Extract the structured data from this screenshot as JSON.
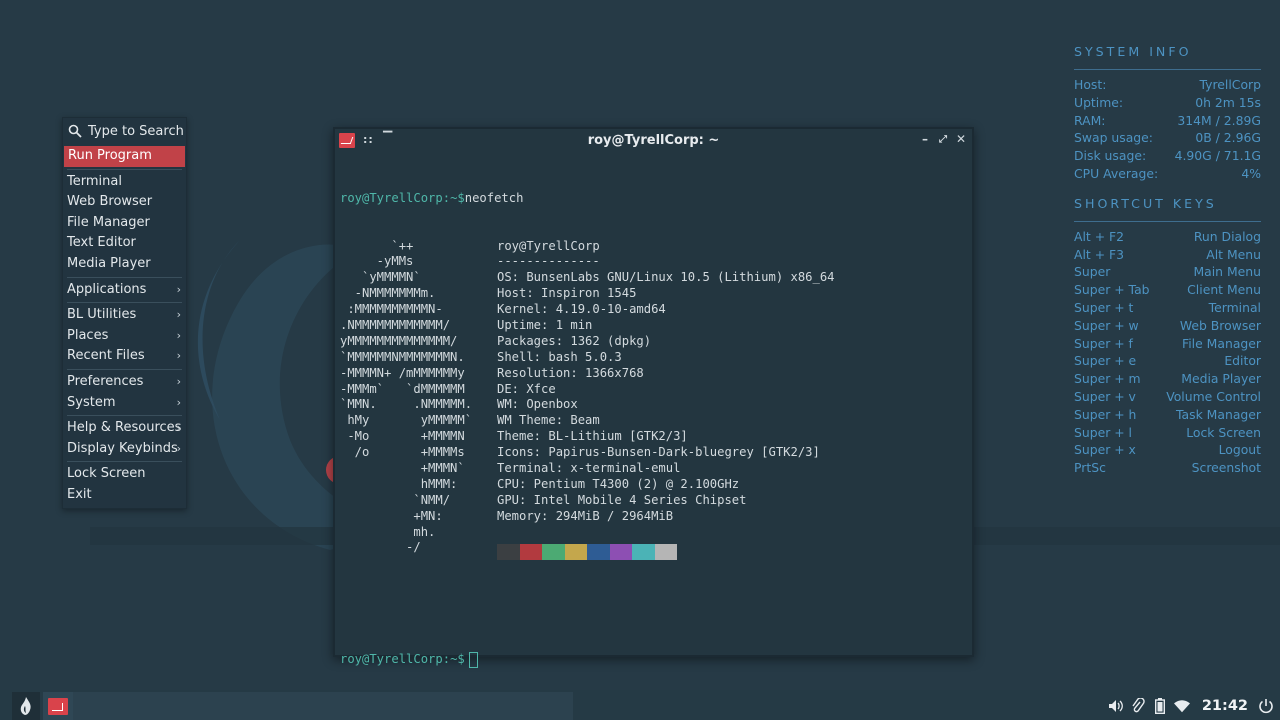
{
  "menu": {
    "search_label": "Type to Search",
    "items": [
      {
        "label": "Run Program",
        "active": true
      },
      {
        "label": "Terminal"
      },
      {
        "label": "Web Browser"
      },
      {
        "label": "File Manager"
      },
      {
        "label": "Text Editor"
      },
      {
        "label": "Media Player"
      },
      {
        "label": "Applications",
        "submenu": true
      },
      {
        "label": "BL Utilities",
        "submenu": true
      },
      {
        "label": "Places",
        "submenu": true
      },
      {
        "label": "Recent Files",
        "submenu": true
      },
      {
        "label": "Preferences",
        "submenu": true
      },
      {
        "label": "System",
        "submenu": true
      },
      {
        "label": "Help & Resources",
        "submenu": true
      },
      {
        "label": "Display Keybinds",
        "submenu": true
      },
      {
        "label": "Lock Screen"
      },
      {
        "label": "Exit"
      }
    ],
    "submenu_arrow": "›"
  },
  "terminal": {
    "title": "roy@TyrellCorp: ~",
    "prompt_user": "roy@TyrellCorp",
    "prompt_path": ":~$",
    "command": "neofetch",
    "logo": [
      "       `++",
      "     -yMMs",
      "   `yMMMMN`",
      "  -NMMMMMMMm.",
      " :MMMMMMMMMMN-",
      ".NMMMMMMMMMMMM/",
      "yMMMMMMMMMMMMMM/",
      "`MMMMMMNMMMMMMMN.",
      "-MMMMN+ /mMMMMMMy",
      "-MMMm`   `dMMMMMM",
      "`MMN.     .NMMMMM.",
      " hMy       yMMMMM`",
      " -Mo       +MMMMN",
      "  /o       +MMMMs",
      "           +MMMN`",
      "           hMMM:",
      "          `NMM/",
      "          +MN:",
      "          mh.",
      "         -/"
    ],
    "info": [
      "roy@TyrellCorp",
      "--------------",
      "OS: BunsenLabs GNU/Linux 10.5 (Lithium) x86_64",
      "Host: Inspiron 1545",
      "Kernel: 4.19.0-10-amd64",
      "Uptime: 1 min",
      "Packages: 1362 (dpkg)",
      "Shell: bash 5.0.3",
      "Resolution: 1366x768",
      "DE: Xfce",
      "WM: Openbox",
      "WM Theme: Beam",
      "Theme: BL-Lithium [GTK2/3]",
      "Icons: Papirus-Bunsen-Dark-bluegrey [GTK2/3]",
      "Terminal: x-terminal-emul",
      "CPU: Pentium T4300 (2) @ 2.100GHz",
      "GPU: Intel Mobile 4 Series Chipset",
      "Memory: 294MiB / 2964MiB",
      ""
    ],
    "swatches": [
      "#3b3f42",
      "#b23a3f",
      "#4caa73",
      "#c4a74c",
      "#2e5c94",
      "#8d4fb3",
      "#4bb3b6",
      "#b5b5b5"
    ]
  },
  "conky": {
    "system_title": "SYSTEM INFO",
    "system": [
      {
        "k": "Host:",
        "v": "TyrellCorp"
      },
      {
        "k": "Uptime:",
        "v": "0h 2m 15s"
      },
      {
        "k": "RAM:",
        "v": "314M / 2.89G"
      },
      {
        "k": "Swap usage:",
        "v": "0B / 2.96G"
      },
      {
        "k": "Disk usage:",
        "v": "4.90G / 71.1G"
      },
      {
        "k": "CPU Average:",
        "v": "4%"
      }
    ],
    "shortcut_title": "SHORTCUT KEYS",
    "shortcuts": [
      {
        "k": "Alt + F2",
        "v": "Run Dialog"
      },
      {
        "k": "Alt + F3",
        "v": "Alt Menu"
      },
      {
        "k": "Super",
        "v": "Main Menu"
      },
      {
        "k": "Super + Tab",
        "v": "Client Menu"
      },
      {
        "k": "Super + t",
        "v": "Terminal"
      },
      {
        "k": "Super + w",
        "v": "Web Browser"
      },
      {
        "k": "Super + f",
        "v": "File Manager"
      },
      {
        "k": "Super + e",
        "v": "Editor"
      },
      {
        "k": "Super + m",
        "v": "Media Player"
      },
      {
        "k": "Super + v",
        "v": "Volume Control"
      },
      {
        "k": "Super + h",
        "v": "Task Manager"
      },
      {
        "k": "Super + l",
        "v": "Lock Screen"
      },
      {
        "k": "Super + x",
        "v": "Logout"
      },
      {
        "k": "PrtSc",
        "v": "Screenshot"
      }
    ]
  },
  "taskbar": {
    "clock": "21:42",
    "tray_icons": [
      "volume-icon",
      "clipboard-icon",
      "battery-icon",
      "wifi-icon",
      "power-icon"
    ]
  }
}
